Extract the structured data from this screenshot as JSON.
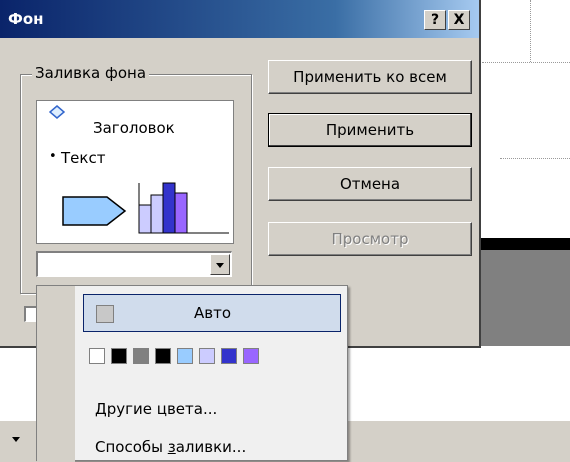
{
  "dialog": {
    "title": "Фон",
    "help_label": "?",
    "close_label": "X"
  },
  "fill_group": {
    "label": "Заливка фона",
    "preview": {
      "title_text": "Заголовок",
      "bullet": "•",
      "body_text": "Текст"
    }
  },
  "buttons": {
    "apply_all": "Применить ко всем",
    "apply": "Применить",
    "cancel": "Отмена",
    "preview": "Просмотр"
  },
  "color_menu": {
    "auto_label": "Авто",
    "swatches": [
      "#ffffff",
      "#000000",
      "#808080",
      "#000000",
      "#99ccff",
      "#ccccff",
      "#3333cc",
      "#9966ff"
    ],
    "more_colors_prefix": "",
    "more_colors_hotkey": "Д",
    "more_colors_rest": "ругие цвета...",
    "fill_effects_prefix": "Способы ",
    "fill_effects_hotkey": "з",
    "fill_effects_rest": "аливки..."
  },
  "colors": {
    "titlebar_start": "#0a246a",
    "titlebar_end": "#a6caf0",
    "dialog_face": "#d4d0c8",
    "preview_shape_fill": "#99ccff",
    "preview_bar_dark": "#3333cc"
  }
}
